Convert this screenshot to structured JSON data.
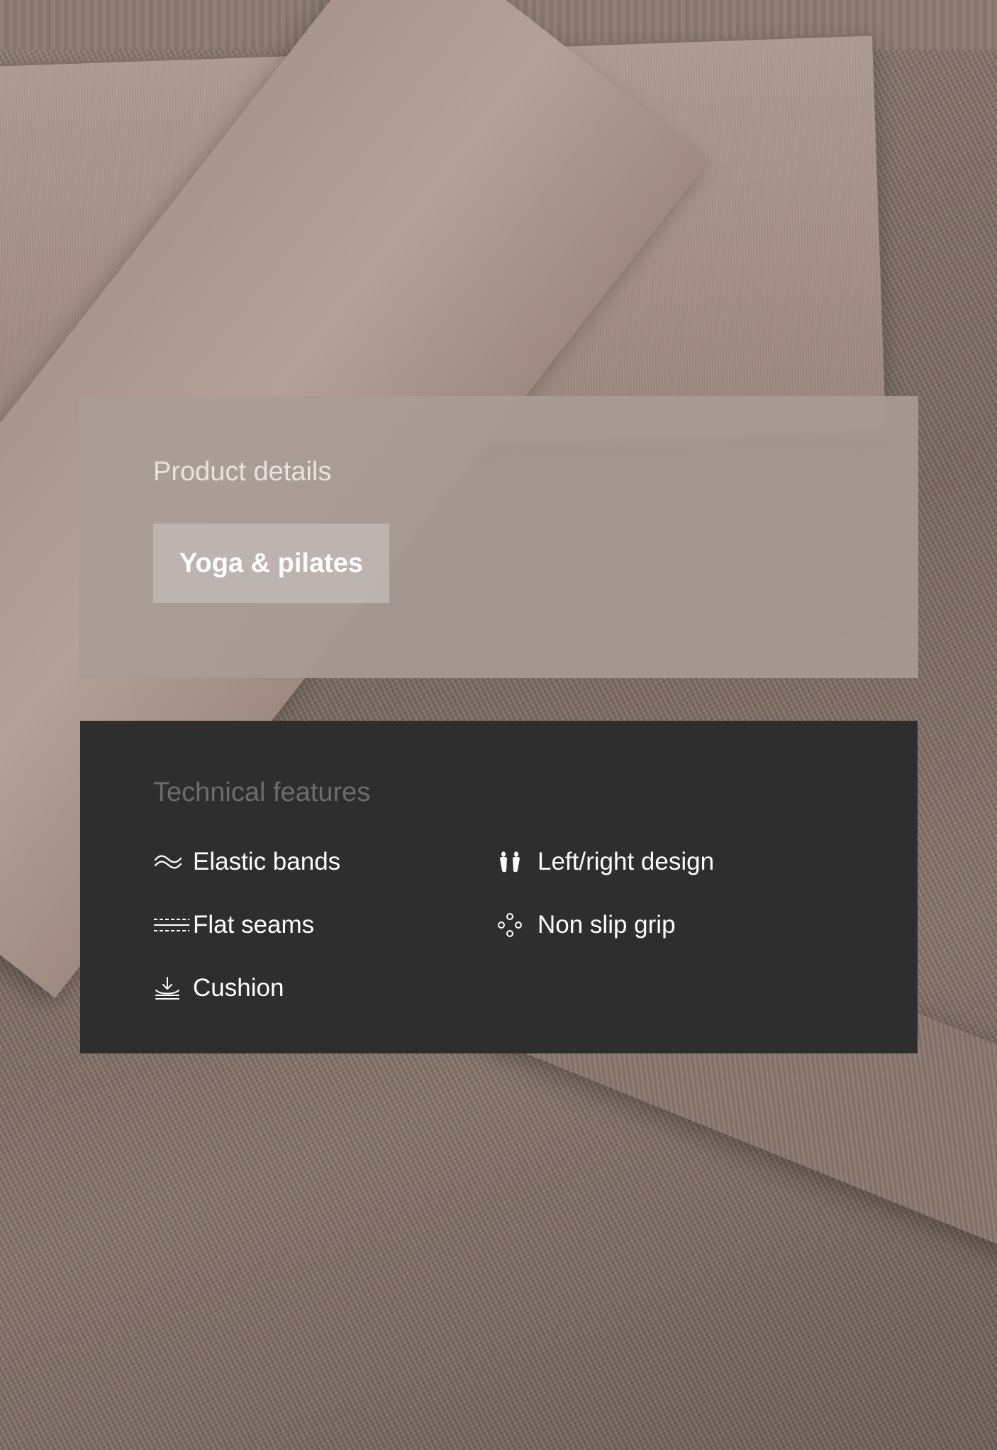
{
  "product_details": {
    "title": "Product details",
    "activity_tag": "Yoga & pilates"
  },
  "technical_features": {
    "title": "Technical features",
    "items": [
      {
        "label": "Elastic bands",
        "icon": "wave-icon"
      },
      {
        "label": "Left/right design",
        "icon": "footprints-icon"
      },
      {
        "label": "Flat seams",
        "icon": "flat-seam-icon"
      },
      {
        "label": "Non slip grip",
        "icon": "grip-dots-icon"
      },
      {
        "label": "Cushion",
        "icon": "cushion-icon"
      }
    ]
  },
  "colors": {
    "details_card": "#a89c96",
    "features_card": "#2e2e2e",
    "muted_title": "#6c6c6c",
    "text": "#ffffff"
  }
}
